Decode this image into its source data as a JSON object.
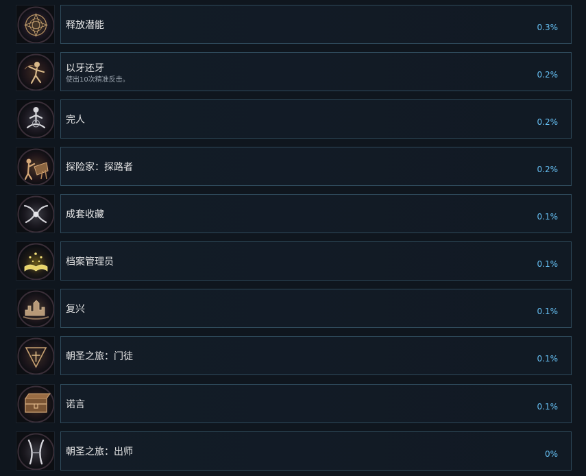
{
  "achievements": [
    {
      "title": "释放潜能",
      "description": "",
      "percent": "0.3%",
      "icon": "rune-circle-icon"
    },
    {
      "title": "以牙还牙",
      "description": "使出10次精准反击。",
      "percent": "0.2%",
      "icon": "dancing-figure-icon"
    },
    {
      "title": "完人",
      "description": "",
      "percent": "0.2%",
      "icon": "meditating-figure-icon"
    },
    {
      "title": "探险家：探路者",
      "description": "",
      "percent": "0.2%",
      "icon": "explorer-telescope-icon"
    },
    {
      "title": "成套收藏",
      "description": "",
      "percent": "0.1%",
      "icon": "hands-collection-icon"
    },
    {
      "title": "档案管理员",
      "description": "",
      "percent": "0.1%",
      "icon": "glowing-book-icon"
    },
    {
      "title": "复兴",
      "description": "",
      "percent": "0.1%",
      "icon": "ruined-city-icon"
    },
    {
      "title": "朝圣之旅：门徒",
      "description": "",
      "percent": "0.1%",
      "icon": "pilgrim-triangle-icon"
    },
    {
      "title": "诺言",
      "description": "",
      "percent": "0.1%",
      "icon": "treasure-chest-icon"
    },
    {
      "title": "朝圣之旅：出师",
      "description": "",
      "percent": "0%",
      "icon": "crossed-blades-icon"
    }
  ],
  "colors": {
    "background": "#0f161e",
    "panel_border": "#2f4b5c",
    "title": "#e8e8e8",
    "description": "#9aa3ad",
    "percent": "#66c0f4"
  }
}
